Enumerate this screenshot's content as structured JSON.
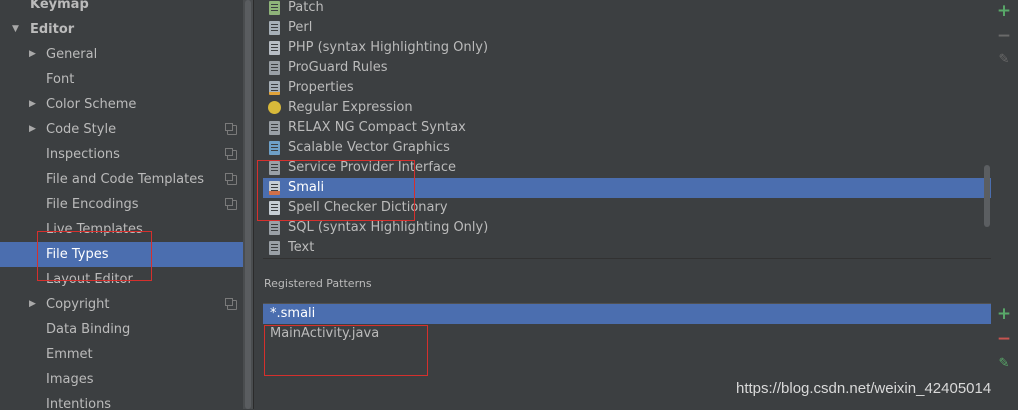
{
  "settings_tree": {
    "items": [
      {
        "label": "Keymap",
        "level": 0,
        "arrow": "",
        "scope": false,
        "selected": false
      },
      {
        "label": "Editor",
        "level": 0,
        "arrow": "down",
        "scope": false,
        "selected": false
      },
      {
        "label": "General",
        "level": 1,
        "arrow": "right",
        "scope": false,
        "selected": false
      },
      {
        "label": "Font",
        "level": 1,
        "arrow": "",
        "scope": false,
        "selected": false
      },
      {
        "label": "Color Scheme",
        "level": 1,
        "arrow": "right",
        "scope": false,
        "selected": false
      },
      {
        "label": "Code Style",
        "level": 1,
        "arrow": "right",
        "scope": true,
        "selected": false
      },
      {
        "label": "Inspections",
        "level": 1,
        "arrow": "",
        "scope": true,
        "selected": false
      },
      {
        "label": "File and Code Templates",
        "level": 1,
        "arrow": "",
        "scope": true,
        "selected": false
      },
      {
        "label": "File Encodings",
        "level": 1,
        "arrow": "",
        "scope": true,
        "selected": false
      },
      {
        "label": "Live Templates",
        "level": 1,
        "arrow": "",
        "scope": false,
        "selected": false
      },
      {
        "label": "File Types",
        "level": 1,
        "arrow": "",
        "scope": false,
        "selected": true
      },
      {
        "label": "Layout Editor",
        "level": 1,
        "arrow": "",
        "scope": false,
        "selected": false
      },
      {
        "label": "Copyright",
        "level": 1,
        "arrow": "right",
        "scope": true,
        "selected": false
      },
      {
        "label": "Data Binding",
        "level": 1,
        "arrow": "",
        "scope": false,
        "selected": false
      },
      {
        "label": "Emmet",
        "level": 1,
        "arrow": "",
        "scope": false,
        "selected": false
      },
      {
        "label": "Images",
        "level": 1,
        "arrow": "",
        "scope": false,
        "selected": false
      },
      {
        "label": "Intentions",
        "level": 1,
        "arrow": "",
        "scope": false,
        "selected": false
      }
    ]
  },
  "file_types": {
    "items": [
      {
        "label": "Patch",
        "icon": "patch-file-icon",
        "selected": false
      },
      {
        "label": "Perl",
        "icon": "perl-file-icon",
        "selected": false
      },
      {
        "label": "PHP (syntax Highlighting Only)",
        "icon": "php-file-icon",
        "selected": false
      },
      {
        "label": "ProGuard Rules",
        "icon": "proguard-file-icon",
        "selected": false
      },
      {
        "label": "Properties",
        "icon": "properties-file-icon",
        "selected": false
      },
      {
        "label": "Regular Expression",
        "icon": "regex-file-icon",
        "selected": false
      },
      {
        "label": "RELAX NG Compact Syntax",
        "icon": "relaxng-file-icon",
        "selected": false
      },
      {
        "label": "Scalable Vector Graphics",
        "icon": "svg-file-icon",
        "selected": false
      },
      {
        "label": "Service Provider Interface",
        "icon": "spi-file-icon",
        "selected": false
      },
      {
        "label": "Smali",
        "icon": "smali-file-icon",
        "selected": true
      },
      {
        "label": "Spell Checker Dictionary",
        "icon": "dictionary-file-icon",
        "selected": false
      },
      {
        "label": "SQL (syntax Highlighting Only)",
        "icon": "sql-file-icon",
        "selected": false
      },
      {
        "label": "Text",
        "icon": "text-file-icon",
        "selected": false
      }
    ],
    "toolbar": {
      "add": "+",
      "remove": "−",
      "edit": "✎"
    }
  },
  "registered_patterns": {
    "title": "Registered Patterns",
    "items": [
      {
        "label": "*.smali",
        "selected": true
      },
      {
        "label": "MainActivity.java",
        "selected": false
      }
    ],
    "toolbar": {
      "add": "+",
      "remove": "−",
      "edit": "✎"
    }
  },
  "watermark": "https://blog.csdn.net/weixin_42405014",
  "colors": {
    "background": "#3c3f41",
    "selection": "#4b6eaf",
    "text": "#bbbbbb",
    "annotation": "#d5302d",
    "add": "#59a869",
    "remove": "#c75450"
  }
}
